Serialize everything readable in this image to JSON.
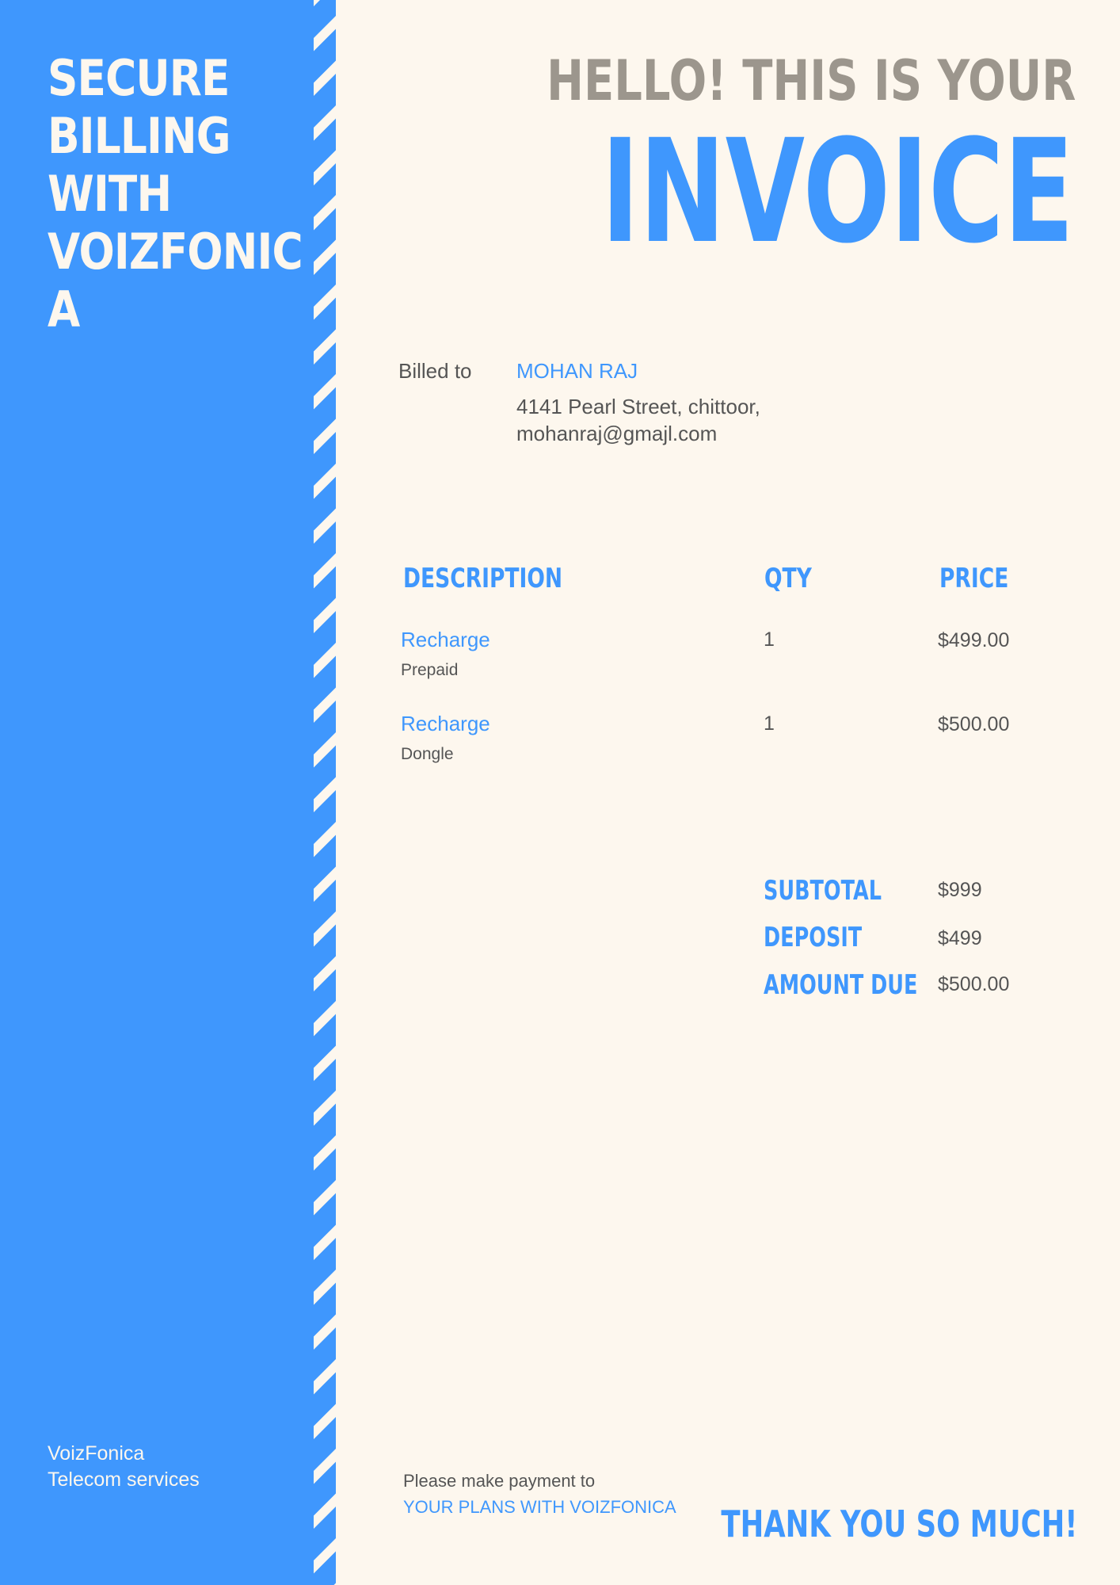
{
  "colors": {
    "accent": "#3f97fd",
    "background": "#fdf7ee",
    "muted": "#9c968d",
    "text": "#555555"
  },
  "sidebar": {
    "title_lines": [
      "SECURE",
      "BILLING",
      "WITH",
      "VOIZFONIC",
      "A"
    ],
    "company_name": "VoizFonica",
    "company_tagline": "Telecom services"
  },
  "header": {
    "greeting": "HELLO! THIS IS YOUR",
    "title": "INVOICE"
  },
  "billing": {
    "label": "Billed to",
    "name": "MOHAN RAJ",
    "address": "4141 Pearl Street, chittoor,",
    "email": "mohanraj@gmajl.com"
  },
  "table": {
    "headers": {
      "description": "DESCRIPTION",
      "qty": "QTY",
      "price": "PRICE"
    },
    "items": [
      {
        "name": "Recharge",
        "detail": "Prepaid",
        "qty": "1",
        "price": "$499.00"
      },
      {
        "name": "Recharge",
        "detail": "Dongle",
        "qty": "1",
        "price": "$500.00"
      }
    ]
  },
  "summary": {
    "subtotal_label": "SUBTOTAL",
    "subtotal": "$999",
    "deposit_label": "DEPOSIT",
    "deposit": "$499",
    "amount_due_label": "AMOUNT DUE",
    "amount_due": "$500.00"
  },
  "footer": {
    "payment_label": "Please make payment to",
    "payment_target": "YOUR PLANS WITH VOIZFONICA",
    "thanks": "THANK YOU SO MUCH!"
  }
}
